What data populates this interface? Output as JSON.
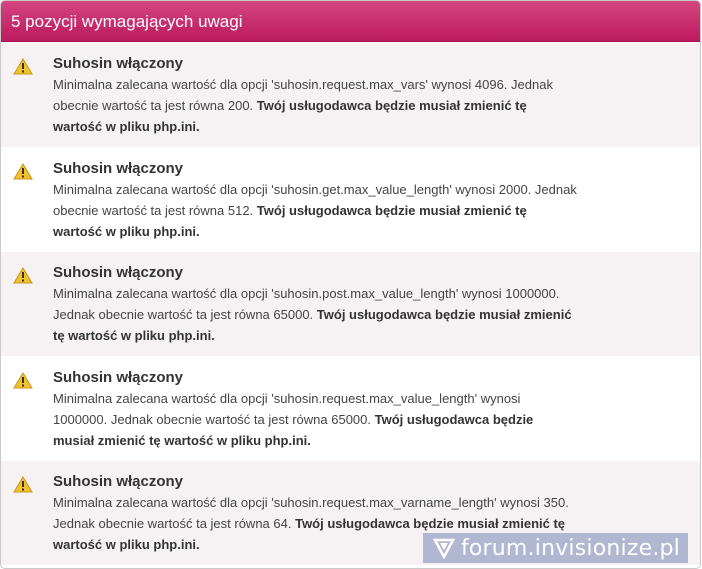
{
  "header": {
    "title": "5 pozycji wymagających uwagi"
  },
  "items": [
    {
      "title": "Suhosin włączony",
      "message": "Minimalna zalecana wartość dla opcji 'suhosin.request.max_vars' wynosi 4096. Jednak obecnie wartość ta jest równa 200.",
      "action": "Twój usługodawca będzie musiał zmienić tę wartość w pliku php.ini."
    },
    {
      "title": "Suhosin włączony",
      "message": "Minimalna zalecana wartość dla opcji 'suhosin.get.max_value_length' wynosi 2000. Jednak obecnie wartość ta jest równa 512.",
      "action": "Twój usługodawca będzie musiał zmienić tę wartość w pliku php.ini."
    },
    {
      "title": "Suhosin włączony",
      "message": "Minimalna zalecana wartość dla opcji 'suhosin.post.max_value_length' wynosi 1000000. Jednak obecnie wartość ta jest równa 65000.",
      "action": "Twój usługodawca będzie musiał zmienić tę wartość w pliku php.ini."
    },
    {
      "title": "Suhosin włączony",
      "message": "Minimalna zalecana wartość dla opcji 'suhosin.request.max_value_length' wynosi 1000000. Jednak obecnie wartość ta jest równa 65000.",
      "action": "Twój usługodawca będzie musiał zmienić tę wartość w pliku php.ini."
    },
    {
      "title": "Suhosin włączony",
      "message": "Minimalna zalecana wartość dla opcji 'suhosin.request.max_varname_length' wynosi 350. Jednak obecnie wartość ta jest równa 64.",
      "action": "Twój usługodawca będzie musiał zmienić tę wartość w pliku php.ini."
    }
  ],
  "watermark": {
    "text": "forum.invisionize.pl"
  },
  "colors": {
    "header_start": "#d4457f",
    "header_end": "#bc1a5e",
    "row_shade": "#f6f2f4",
    "warning_icon": "#f2c12e"
  }
}
